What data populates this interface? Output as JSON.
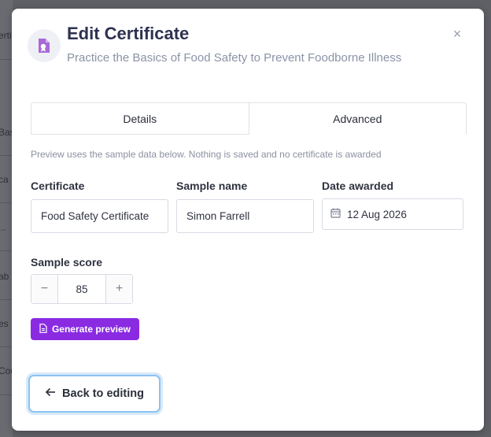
{
  "background": {
    "fragments": [
      "ertif",
      "Bas",
      "ca",
      "...",
      "ab",
      "es",
      "Cou"
    ]
  },
  "dialog": {
    "title": "Edit Certificate",
    "subtitle": "Practice the Basics of Food Safety to Prevent Foodborne Illness",
    "header_icon": "certificate-icon",
    "close_label": "×"
  },
  "tabs": [
    {
      "label": "Details"
    },
    {
      "label": "Advanced"
    }
  ],
  "hint": "Preview uses the sample data below. Nothing is saved and no certificate is awarded",
  "fields": {
    "certificate": {
      "label": "Certificate",
      "value": "Food Safety Certificate"
    },
    "sample_name": {
      "label": "Sample name",
      "value": "Simon Farrell"
    },
    "date_awarded": {
      "label": "Date awarded",
      "value": "12 Aug 2026",
      "icon": "calendar-icon"
    },
    "sample_score": {
      "label": "Sample score",
      "value": "85",
      "minus": "−",
      "plus": "+"
    }
  },
  "buttons": {
    "generate": "Generate preview",
    "back": "Back to editing"
  },
  "colors": {
    "primary": "#8a2be2",
    "title": "#2d3250",
    "focus_ring": "#8cc2f2"
  }
}
